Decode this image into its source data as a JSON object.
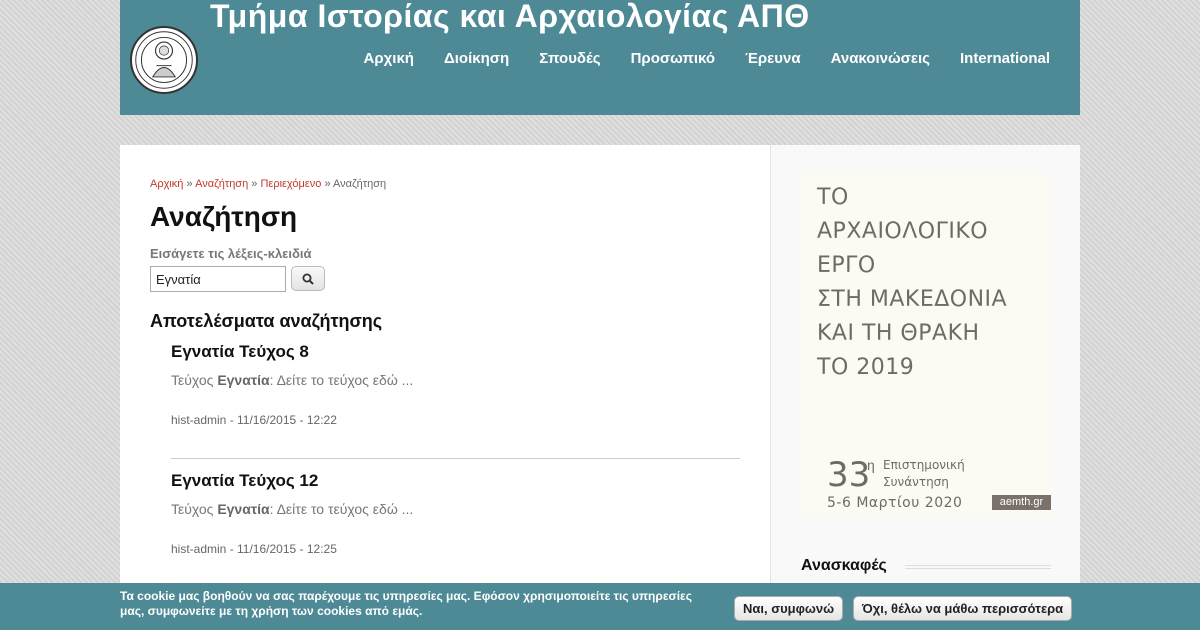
{
  "header": {
    "title": "Τμήμα Ιστορίας και Αρχαιολογίας ΑΠΘ",
    "logo_icon": "university-seal-icon",
    "nav": [
      "Αρχική",
      "Διοίκηση",
      "Σπουδές",
      "Προσωπικό",
      "Έρευνα",
      "Ανακοινώσεις",
      "International"
    ]
  },
  "breadcrumb": {
    "items": [
      "Αρχική",
      "Αναζήτηση",
      "Περιεχόμενο"
    ],
    "separator": "»",
    "current": "Αναζήτηση"
  },
  "main": {
    "title": "Αναζήτηση",
    "keywords_label": "Εισάγετε τις λέξεις-κλειδιά",
    "search_value": "Εγνατία",
    "search_icon": "search-icon",
    "results_heading": "Αποτελέσματα αναζήτησης",
    "results": [
      {
        "title": "Εγνατία Τεύχος 8",
        "snippet_prefix": "Τεύχος",
        "snippet_highlight": "Εγνατία",
        "snippet_suffix": ":  Δείτε το τεύχος εδώ ...",
        "meta": "hist-admin - 11/16/2015 - 12:22"
      },
      {
        "title": "Εγνατία Τεύχος 12",
        "snippet_prefix": "Τεύχος",
        "snippet_highlight": "Εγνατία",
        "snippet_suffix": ":  Δείτε το τεύχος εδώ ...",
        "meta": "hist-admin - 11/16/2015 - 12:25"
      }
    ]
  },
  "sidebar": {
    "banner": {
      "lines": [
        "ΤΟ",
        "ΑΡΧΑΙΟΛΟΓΙΚΟ",
        "ΕΡΓΟ",
        "ΣΤΗ ΜΑΚΕΔΟΝΙΑ",
        "ΚΑΙ ΤΗ ΘΡΑΚΗ",
        "ΤΟ 2019"
      ],
      "number": "33",
      "number_sup": "η",
      "sub1": "Επιστημονική",
      "sub2": "Συνάντηση",
      "date": "5-6 Μαρτίου 2020",
      "site": "aemth.gr"
    },
    "section_heading": "Ανασκαφές"
  },
  "cookie": {
    "text": "Τα cookie μας βοηθούν να σας παρέχουμε τις υπηρεσίες μας. Εφόσον χρησιμοποιείτε τις υπηρεσίες μας, συμφωνείτε με τη χρήση των cookies από εμάς.",
    "accept": "Ναι, συμφωνώ",
    "more": "Όχι, θέλω να μάθω περισσότερα"
  },
  "colors": {
    "header_bg": "#4e8a96",
    "breadcrumb_link": "#c0392b"
  }
}
